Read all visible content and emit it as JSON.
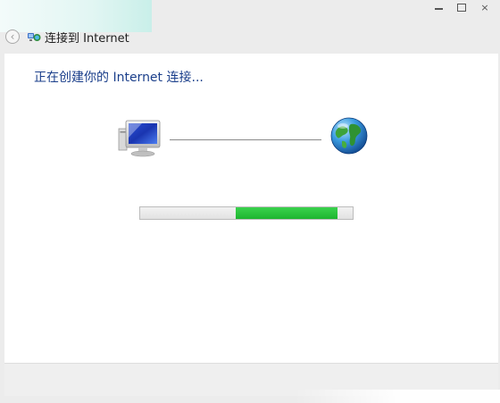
{
  "window": {
    "title": "连接到 Internet",
    "caption_buttons": {
      "minimize_icon": "minimize-icon",
      "maximize_icon": "maximize-icon",
      "close_glyph": "×"
    }
  },
  "main": {
    "heading": "正在创建你的 Internet 连接...",
    "progress": {
      "start_fraction": 0.45,
      "end_fraction": 0.93,
      "color": "#22c036"
    },
    "icons": [
      "computer-icon",
      "globe-icon",
      "network-icon",
      "back-arrow-icon"
    ]
  },
  "colors": {
    "heading": "#1b3f8b",
    "accent_strip": "#c9efe9",
    "progress_green": "#22c036"
  }
}
